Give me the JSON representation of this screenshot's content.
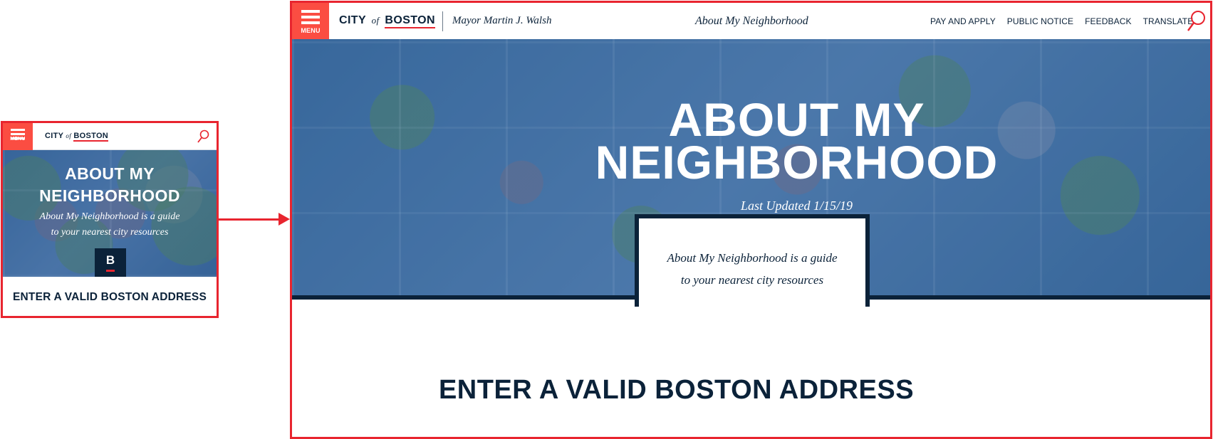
{
  "mobile": {
    "menu_label": "MENU",
    "logo": {
      "city": "CITY",
      "of": "of",
      "boston": "BOSTON"
    },
    "hero_title_line1": "ABOUT MY",
    "hero_title_line2": "NEIGHBORHOOD",
    "hero_sub_line1": "About My Neighborhood is a guide",
    "hero_sub_line2": "to your nearest city resources",
    "badge_letter": "B",
    "enter_address": "ENTER A VALID BOSTON ADDRESS"
  },
  "desktop": {
    "menu_label": "MENU",
    "logo": {
      "city": "CITY",
      "of": "of",
      "boston": "BOSTON"
    },
    "mayor": "Mayor Martin J. Walsh",
    "page_name": "About My Neighborhood",
    "nav": [
      "PAY AND APPLY",
      "PUBLIC NOTICE",
      "FEEDBACK",
      "TRANSLATE"
    ],
    "hero_title_line1": "ABOUT MY",
    "hero_title_line2": "NEIGHBORHOOD",
    "last_updated": "Last Updated 1/15/19",
    "card_line1": "About My Neighborhood is a guide",
    "card_line2": "to your nearest city resources",
    "enter_address": "ENTER A VALID BOSTON ADDRESS"
  },
  "colors": {
    "accent_red": "#fb4d42",
    "frame_red": "#e8252f",
    "navy": "#0b2239",
    "hero_blue": "#46719e"
  },
  "icons": [
    "menu-icon",
    "search-icon",
    "arrow-right-icon"
  ]
}
